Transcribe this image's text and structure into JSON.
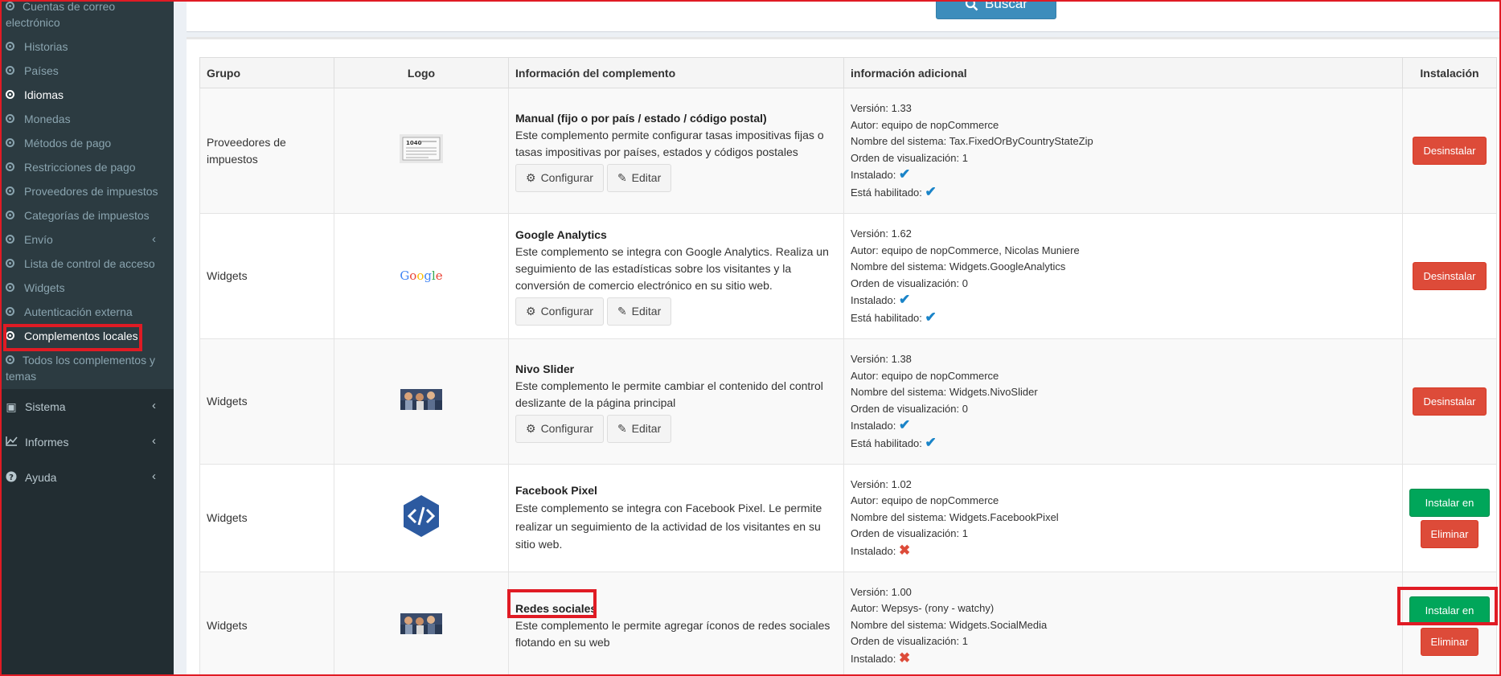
{
  "sidebar": {
    "sub_items": [
      {
        "label": "Cuentas de correo electrónico"
      },
      {
        "label": "Historias"
      },
      {
        "label": "Países"
      },
      {
        "label": "Idiomas"
      },
      {
        "label": "Monedas"
      },
      {
        "label": "Métodos de pago"
      },
      {
        "label": "Restricciones de pago"
      },
      {
        "label": "Proveedores de impuestos"
      },
      {
        "label": "Categorías de impuestos"
      },
      {
        "label": "Envío"
      },
      {
        "label": "Lista de control de acceso"
      },
      {
        "label": "Widgets"
      },
      {
        "label": "Autenticación externa"
      },
      {
        "label": "Complementos locales"
      },
      {
        "label": "Todos los complementos y temas"
      }
    ],
    "main_items": [
      {
        "label": "Sistema",
        "icon": "cube-icon"
      },
      {
        "label": "Informes",
        "icon": "line-chart-icon"
      },
      {
        "label": "Ayuda",
        "icon": "question-circle-icon"
      }
    ]
  },
  "search": {
    "button_label": "Buscar"
  },
  "table": {
    "headers": [
      "Grupo",
      "Logo",
      "Información del complemento",
      "información adicional",
      "Instalación"
    ],
    "labels": {
      "version": "Versión:",
      "author": "Autor:",
      "system_name": "Nombre del sistema:",
      "display_order": "Orden de visualización:",
      "installed": "Instalado:",
      "enabled": "Está habilitado:"
    },
    "buttons": {
      "configure": "Configurar",
      "edit": "Editar",
      "uninstall": "Desinstalar",
      "install": "Instalar en pc",
      "delete": "Eliminar"
    },
    "rows": [
      {
        "group": "Proveedores de impuestos",
        "logo": "tax-form-logo",
        "name": "Manual (fijo o por país / estado / código postal)",
        "description": "Este complemento permite configurar tasas impositivas fijas o tasas impositivas por países, estados y códigos postales",
        "version": "1.33",
        "author": "equipo de nopCommerce",
        "system_name": "Tax.FixedOrByCountryStateZip",
        "display_order": "1",
        "installed": true,
        "enabled": true
      },
      {
        "group": "Widgets",
        "logo": "google-logo",
        "logo_text": "Google",
        "name": "Google Analytics",
        "description": "Este complemento se integra con Google Analytics. Realiza un seguimiento de las estadísticas sobre los visitantes y la conversión de comercio electrónico en su sitio web.",
        "version": "1.62",
        "author": "equipo de nopCommerce, Nicolas Muniere",
        "system_name": "Widgets.GoogleAnalytics",
        "display_order": "0",
        "installed": true,
        "enabled": true
      },
      {
        "group": "Widgets",
        "logo": "nivo-slider-logo",
        "name": "Nivo Slider",
        "description": "Este complemento le permite cambiar el contenido del control deslizante de la página principal",
        "version": "1.38",
        "author": "equipo de nopCommerce",
        "system_name": "Widgets.NivoSlider",
        "display_order": "0",
        "installed": true,
        "enabled": true
      },
      {
        "group": "Widgets",
        "logo": "code-hexagon-logo",
        "name": "Facebook Pixel",
        "description": "Este complemento se integra con Facebook Pixel. Le permite realizar un seguimiento de la actividad de los visitantes en su sitio web.",
        "version": "1.02",
        "author": "equipo de nopCommerce",
        "system_name": "Widgets.FacebookPixel",
        "display_order": "1",
        "installed": false
      },
      {
        "group": "Widgets",
        "logo": "social-media-logo",
        "name": "Redes sociales",
        "description": "Este complemento le permite agregar íconos de redes sociales flotando en su web",
        "version": "1.00",
        "author": "Wepsys- (rony - watchy)",
        "system_name": "Widgets.SocialMedia",
        "display_order": "1",
        "installed": false
      }
    ]
  },
  "colors": {
    "sidebar_bg": "#222d32",
    "submenu_bg": "#2c3b41",
    "primary": "#3c8dbc",
    "danger": "#dd4b39",
    "success": "#00a65a",
    "highlight": "#e01b24",
    "check": "#1a84c8"
  }
}
